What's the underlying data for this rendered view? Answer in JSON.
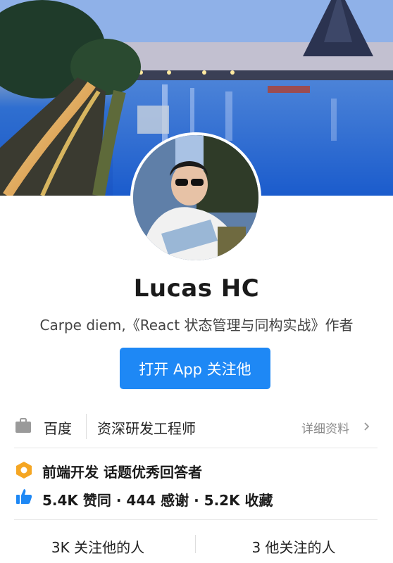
{
  "profile": {
    "name": "Lucas HC",
    "bio": "Carpe diem,《React 状态管理与同构实战》作者",
    "follow_button": "打开 App 关注他"
  },
  "employment": {
    "company": "百度",
    "title": "资深研发工程师",
    "detail_link": "详细资料"
  },
  "achievements": {
    "badge": "前端开发 话题优秀回答者",
    "stats": "5.4K 赞同 · 444 感谢 · 5.2K 收藏"
  },
  "follow_stats": {
    "followers": "3K 关注他的人",
    "following": "3 他关注的人"
  },
  "colors": {
    "accent": "#1e88f5",
    "badge": "#f5a623",
    "thumb": "#1e88f5"
  }
}
